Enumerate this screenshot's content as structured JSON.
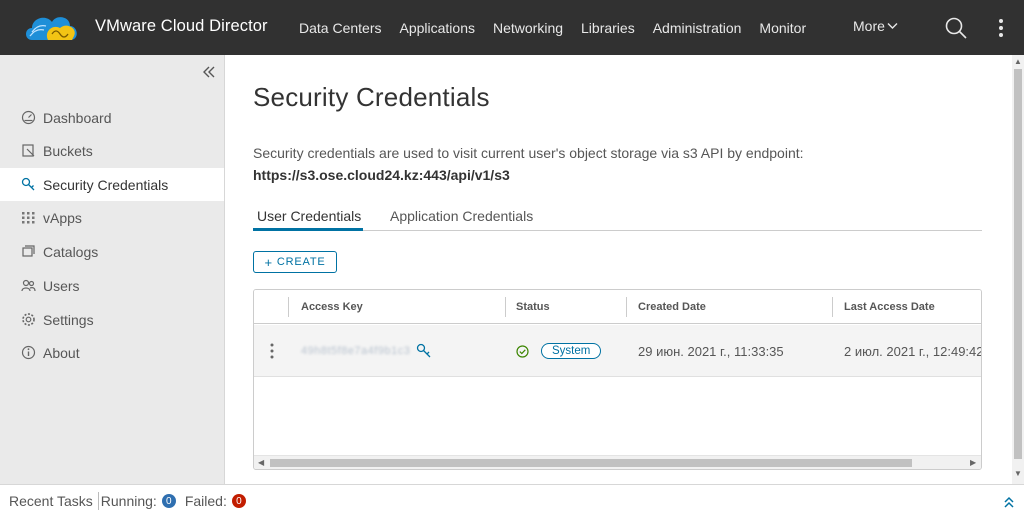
{
  "app": {
    "title": "VMware Cloud Director",
    "nav": [
      "Data Centers",
      "Applications",
      "Networking",
      "Libraries",
      "Administration",
      "Monitor"
    ],
    "more_label": "More",
    "icons": {
      "search": "search-icon",
      "menu": "kebab-icon",
      "logo": "cloud-logo-icon"
    }
  },
  "sidebar": {
    "collapse_icon": "double-chevron-left-icon",
    "items": [
      {
        "label": "Dashboard",
        "icon": "dashboard-icon",
        "active": false
      },
      {
        "label": "Buckets",
        "icon": "bucket-icon",
        "active": false
      },
      {
        "label": "Security Credentials",
        "icon": "key-icon",
        "active": true
      },
      {
        "label": "vApps",
        "icon": "vapps-icon",
        "active": false
      },
      {
        "label": "Catalogs",
        "icon": "catalog-icon",
        "active": false
      },
      {
        "label": "Users",
        "icon": "users-icon",
        "active": false
      },
      {
        "label": "Settings",
        "icon": "gear-icon",
        "active": false
      },
      {
        "label": "About",
        "icon": "info-icon",
        "active": false
      }
    ]
  },
  "page": {
    "title": "Security Credentials",
    "description": "Security credentials are used to visit current user's object storage via s3 API by endpoint:",
    "endpoint": "https://s3.ose.cloud24.kz:443/api/v1/s3",
    "tabs": [
      "User Credentials",
      "Application Credentials"
    ],
    "active_tab": 0,
    "create_label": "CREATE"
  },
  "grid": {
    "columns": [
      "Access Key",
      "Status",
      "Created Date",
      "Last Access Date"
    ],
    "rows": [
      {
        "access_key": "49h8t5f8e7a4f9b1c3",
        "status": "System",
        "created": "29 июн. 2021 г., 11:33:35",
        "last_access": "2 июл. 2021 г., 12:49:42"
      }
    ]
  },
  "footer": {
    "recent_tasks": "Recent Tasks",
    "running_label": "Running:",
    "running_count": "0",
    "failed_label": "Failed:",
    "failed_count": "0",
    "colors": {
      "running": "#2f6fb0",
      "failed": "#c21d00"
    }
  },
  "colors": {
    "header": "#313131",
    "accent": "#0072a3",
    "sidebar": "#eaeaea",
    "status_ok": "#3c8500"
  }
}
